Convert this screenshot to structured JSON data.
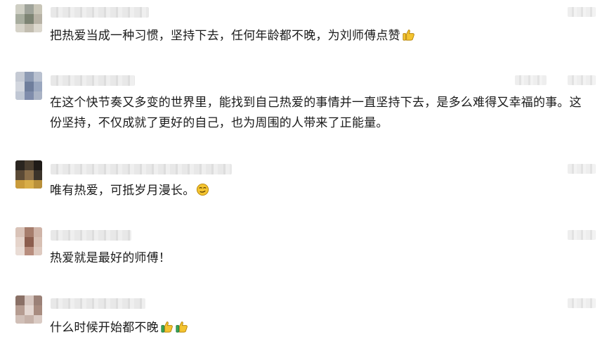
{
  "comments": [
    {
      "text": "把热爱当成一种习惯，坚持下去，任何年龄都不晚，为刘师傅点赞",
      "emoji": [
        "thumbs-up-icon"
      ]
    },
    {
      "text": "在这个快节奏又多变的世界里，能找到自己热爱的事情并一直坚持下去，是多么难得又幸福的事。这份坚持，不仅成就了更好的自己，也为周围的人带来了正能量。",
      "emoji": []
    },
    {
      "text": "唯有热爱，可抵岁月漫长。",
      "emoji": [
        "smirk-face-icon"
      ]
    },
    {
      "text": "热爱就是最好的师傅！",
      "emoji": []
    },
    {
      "text": "什么时候开始都不晚",
      "emoji": [
        "thumbs-up-icon",
        "thumbs-up-icon"
      ]
    }
  ],
  "colors": {
    "text": "#1a1a1a",
    "emoji_yellow": "#f4c430",
    "emoji_outline": "#b8860b",
    "sleeve_green": "#3aa657"
  }
}
